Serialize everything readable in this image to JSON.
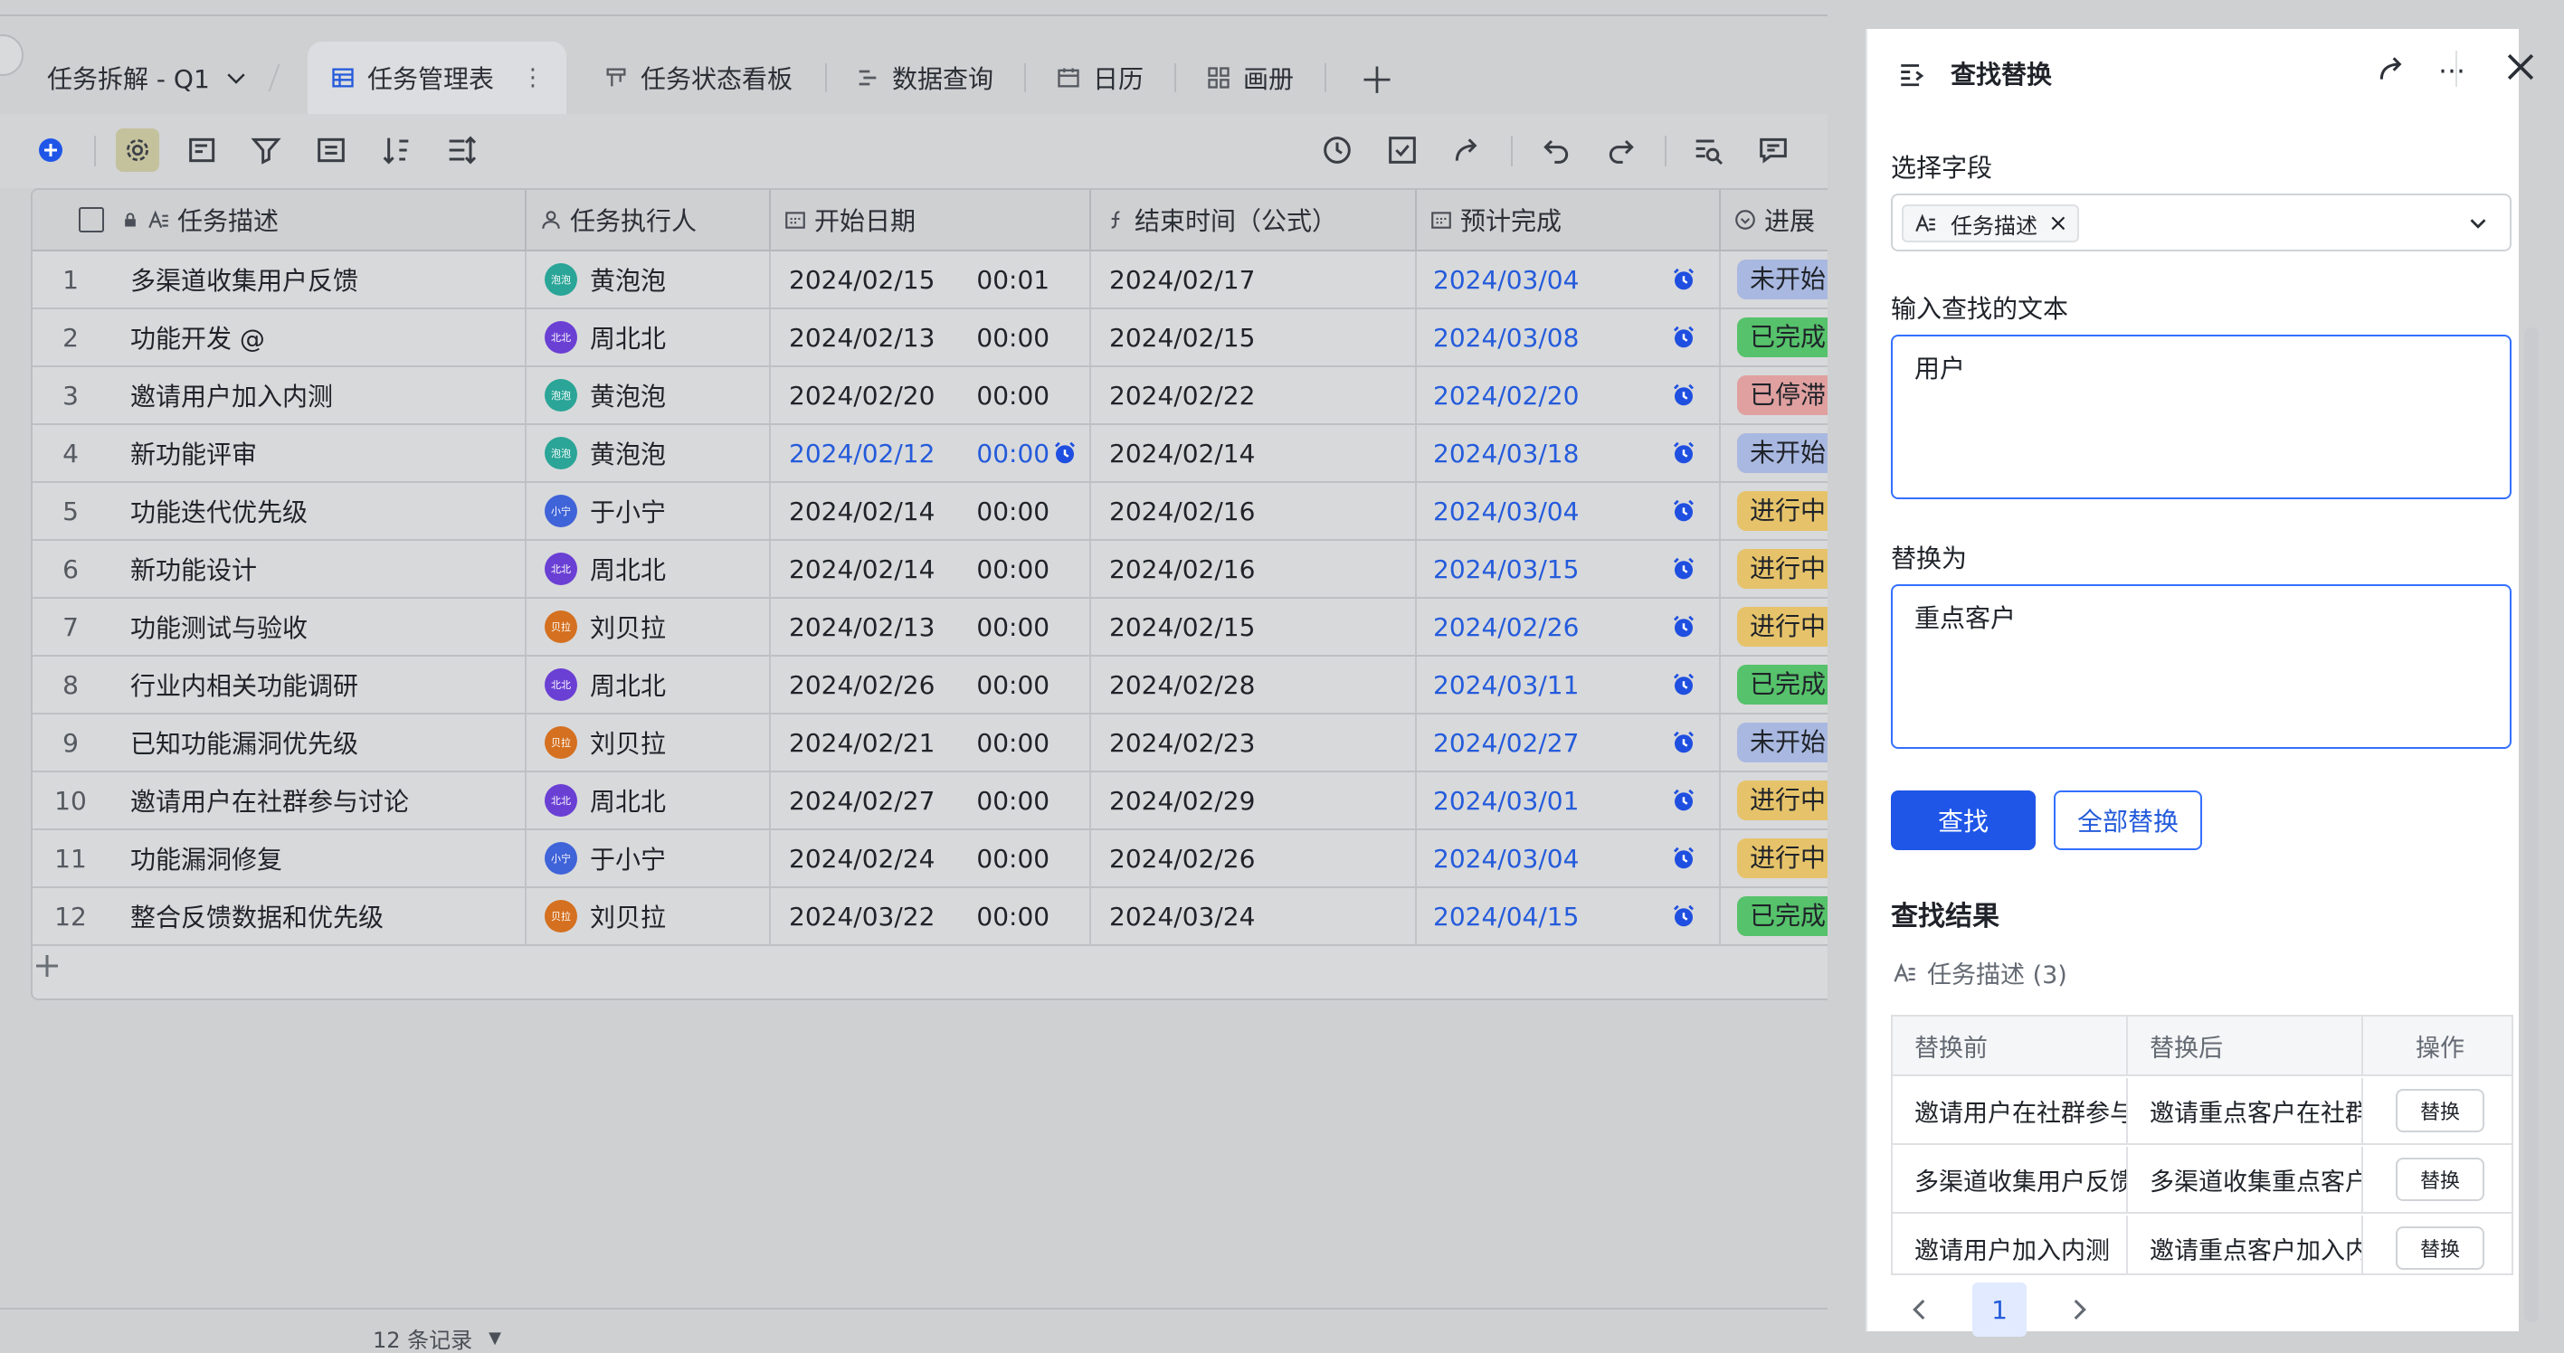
{
  "doc": {
    "title": "任务拆解 - Q1"
  },
  "tabs": [
    {
      "label": "任务管理表",
      "icon": "grid-table-icon",
      "active": true
    },
    {
      "label": "任务状态看板",
      "icon": "kanban-icon"
    },
    {
      "label": "数据查询",
      "icon": "gantt-icon"
    },
    {
      "label": "日历",
      "icon": "calendar-icon"
    },
    {
      "label": "画册",
      "icon": "gallery-icon"
    }
  ],
  "toolbar": {
    "left": [
      "add-record-icon",
      "settings-icon",
      "field-config-icon",
      "filter-icon",
      "group-icon",
      "sort-icon",
      "row-height-icon"
    ],
    "right": [
      "history-icon",
      "check-icon",
      "share-icon",
      "undo-icon",
      "redo-icon",
      "find-replace-icon",
      "comment-icon"
    ]
  },
  "table": {
    "columns": [
      "任务描述",
      "任务执行人",
      "开始日期",
      "结束时间（公式）",
      "预计完成",
      "进展"
    ],
    "rows": [
      {
        "no": "1",
        "desc": "多渠道收集用户反馈",
        "owner": "黄泡泡",
        "owner_tag": "泡泡",
        "start": "2024/02/15",
        "start_time": "00:01",
        "end": "2024/02/17",
        "due": "2024/03/04",
        "status": "未开始"
      },
      {
        "no": "2",
        "desc": "功能开发 @",
        "owner": "周北北",
        "owner_tag": "北北",
        "start": "2024/02/13",
        "start_time": "00:00",
        "end": "2024/02/15",
        "due": "2024/03/08",
        "status": "已完成"
      },
      {
        "no": "3",
        "desc": "邀请用户加入内测",
        "owner": "黄泡泡",
        "owner_tag": "泡泡",
        "start": "2024/02/20",
        "start_time": "00:00",
        "end": "2024/02/22",
        "due": "2024/02/20",
        "status": "已停滞"
      },
      {
        "no": "4",
        "desc": "新功能评审",
        "owner": "黄泡泡",
        "owner_tag": "泡泡",
        "start": "2024/02/12",
        "start_time": "00:00",
        "end": "2024/02/14",
        "due": "2024/03/18",
        "status": "未开始",
        "start_highlight": true
      },
      {
        "no": "5",
        "desc": "功能迭代优先级",
        "owner": "于小宁",
        "owner_tag": "小宁",
        "start": "2024/02/14",
        "start_time": "00:00",
        "end": "2024/02/16",
        "due": "2024/03/04",
        "status": "进行中"
      },
      {
        "no": "6",
        "desc": "新功能设计",
        "owner": "周北北",
        "owner_tag": "北北",
        "start": "2024/02/14",
        "start_time": "00:00",
        "end": "2024/02/16",
        "due": "2024/03/15",
        "status": "进行中"
      },
      {
        "no": "7",
        "desc": "功能测试与验收",
        "owner": "刘贝拉",
        "owner_tag": "贝拉",
        "start": "2024/02/13",
        "start_time": "00:00",
        "end": "2024/02/15",
        "due": "2024/02/26",
        "status": "进行中"
      },
      {
        "no": "8",
        "desc": "行业内相关功能调研",
        "owner": "周北北",
        "owner_tag": "北北",
        "start": "2024/02/26",
        "start_time": "00:00",
        "end": "2024/02/28",
        "due": "2024/03/11",
        "status": "已完成"
      },
      {
        "no": "9",
        "desc": "已知功能漏洞优先级",
        "owner": "刘贝拉",
        "owner_tag": "贝拉",
        "start": "2024/02/21",
        "start_time": "00:00",
        "end": "2024/02/23",
        "due": "2024/02/27",
        "status": "未开始"
      },
      {
        "no": "10",
        "desc": "邀请用户在社群参与讨论",
        "owner": "周北北",
        "owner_tag": "北北",
        "start": "2024/02/27",
        "start_time": "00:00",
        "end": "2024/02/29",
        "due": "2024/03/01",
        "status": "进行中"
      },
      {
        "no": "11",
        "desc": "功能漏洞修复",
        "owner": "于小宁",
        "owner_tag": "小宁",
        "start": "2024/02/24",
        "start_time": "00:00",
        "end": "2024/02/26",
        "due": "2024/03/04",
        "status": "进行中"
      },
      {
        "no": "12",
        "desc": "整合反馈数据和优先级",
        "owner": "刘贝拉",
        "owner_tag": "贝拉",
        "start": "2024/03/22",
        "start_time": "00:00",
        "end": "2024/03/24",
        "due": "2024/04/15",
        "status": "已完成"
      }
    ],
    "record_count": "12 条记录"
  },
  "colors": {
    "owner": {
      "黄泡泡": "#2aa597",
      "周北北": "#6a3fd4",
      "于小宁": "#3f63d8",
      "刘贝拉": "#d4701f"
    },
    "status": {
      "未开始": "#a9b8e0",
      "已完成": "#56c26b",
      "已停滞": "#e0a0a0",
      "进行中": "#e6c36a"
    },
    "accent": "#245bdb"
  },
  "panel": {
    "title": "查找替换",
    "field_label": "选择字段",
    "field_value": "任务描述",
    "find_label": "输入查找的文本",
    "find_value": "用户",
    "replace_label": "替换为",
    "replace_value": "重点客户",
    "find_btn": "查找",
    "replace_all_btn": "全部替换",
    "results_title": "查找结果",
    "results_field": "任务描述 (3)",
    "result_headers": [
      "替换前",
      "替换后",
      "操作"
    ],
    "results": [
      {
        "before": "邀请用户在社群参与讨论",
        "after": "邀请重点客户在社群参与讨论",
        "action": "替换"
      },
      {
        "before": "多渠道收集用户反馈",
        "after": "多渠道收集重点客户反馈",
        "action": "替换"
      },
      {
        "before": "邀请用户加入内测",
        "after": "邀请重点客户加入内测",
        "action": "替换"
      }
    ],
    "page": "1"
  }
}
